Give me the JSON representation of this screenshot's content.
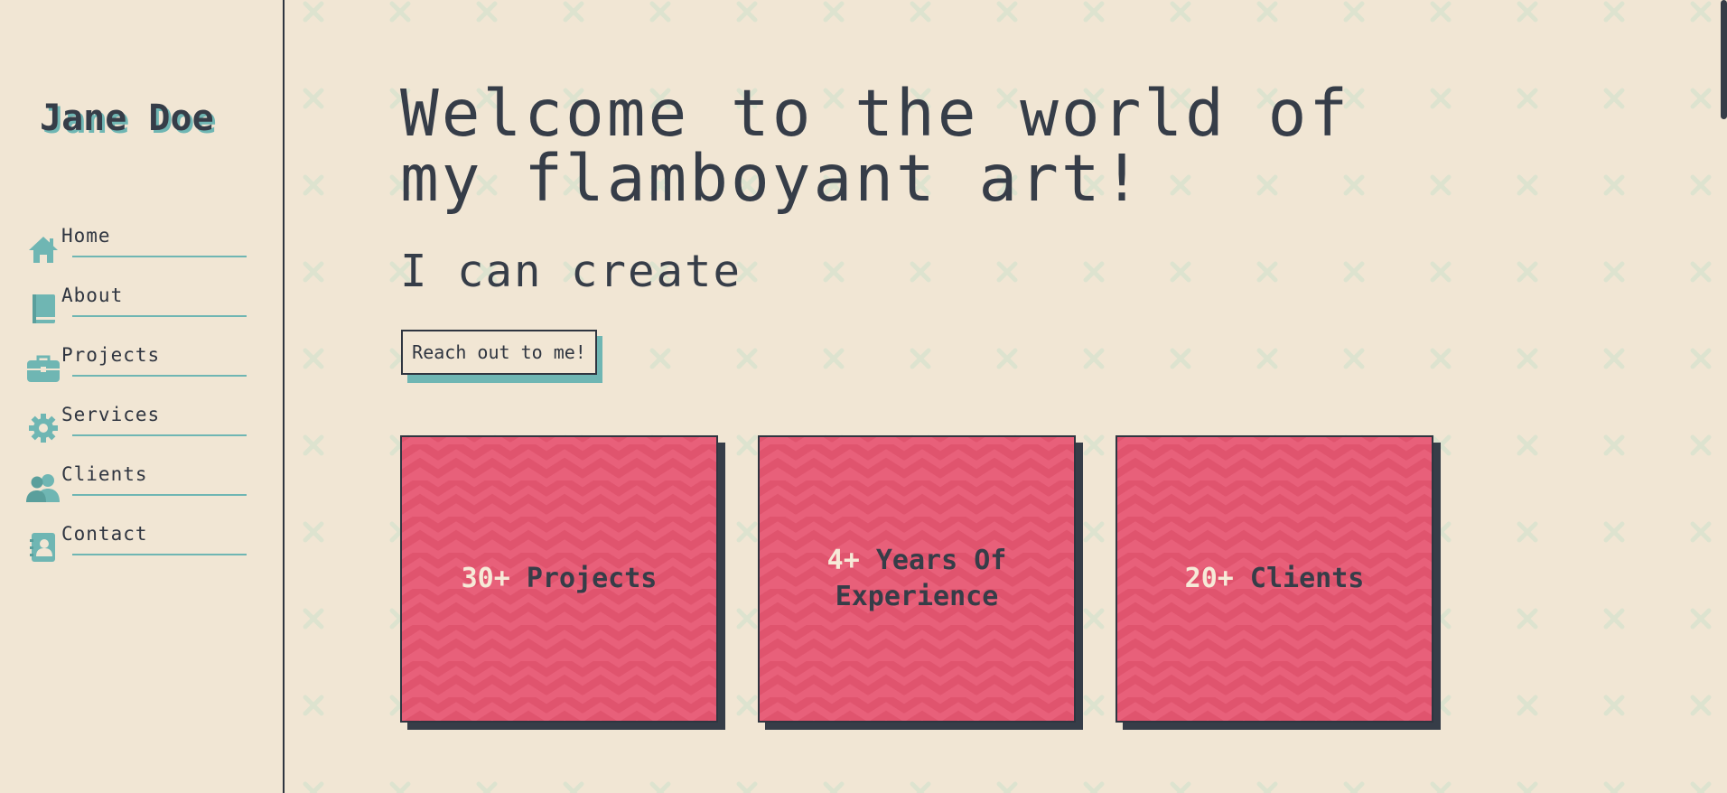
{
  "brand": {
    "name": "Jane Doe"
  },
  "nav": {
    "items": [
      {
        "label": "Home",
        "icon": "home-icon"
      },
      {
        "label": "About",
        "icon": "book-icon"
      },
      {
        "label": "Projects",
        "icon": "briefcase-icon"
      },
      {
        "label": "Services",
        "icon": "gear-icon"
      },
      {
        "label": "Clients",
        "icon": "users-icon"
      },
      {
        "label": "Contact",
        "icon": "contact-card-icon"
      }
    ]
  },
  "hero": {
    "title_line1": "Welcome to the world of",
    "title_line2": "my flamboyant art!",
    "subtitle": "I can create",
    "cta_label": "Reach out to me!"
  },
  "stats": [
    {
      "number": "30+",
      "text": "Projects"
    },
    {
      "number": "4+",
      "text": "Years Of Experience"
    },
    {
      "number": "20+",
      "text": "Clients"
    }
  ],
  "colors": {
    "background": "#f1e6d4",
    "accent": "#6fb6b3",
    "card": "#e8607a",
    "text": "#363d48"
  }
}
